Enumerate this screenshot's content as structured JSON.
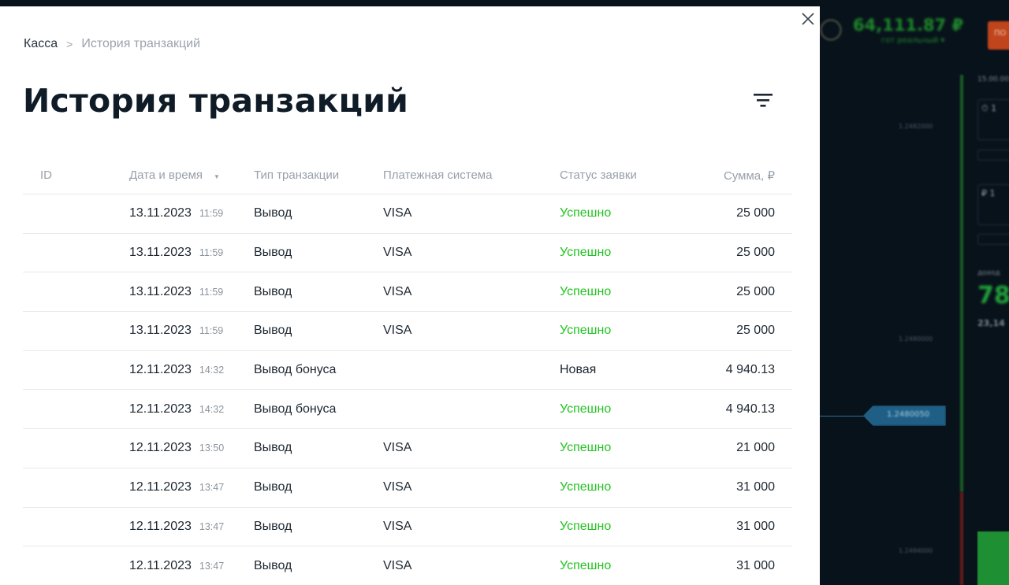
{
  "background": {
    "balance": "64,111.87 ₽",
    "balance_sub": "гот реальный ▾",
    "prices": [
      "1.2482000",
      "1.2480000",
      "1.2480050",
      "1.2484000"
    ],
    "big_value": "78",
    "small_value": "23,14"
  },
  "breadcrumb": {
    "root": "Касса",
    "separator": ">",
    "current": "История транзакций"
  },
  "title": "История транзакций",
  "table": {
    "headers": {
      "id": "ID",
      "date": "Дата и время",
      "type": "Тип транзакции",
      "payment": "Платежная система",
      "status": "Статус заявки",
      "sum": "Сумма, ₽"
    },
    "rows": [
      {
        "date": "13.11.2023",
        "time": "11:59",
        "type": "Вывод",
        "payment": "VISA",
        "status": "Успешно",
        "status_kind": "ok",
        "sum": "25 000"
      },
      {
        "date": "13.11.2023",
        "time": "11:59",
        "type": "Вывод",
        "payment": "VISA",
        "status": "Успешно",
        "status_kind": "ok",
        "sum": "25 000"
      },
      {
        "date": "13.11.2023",
        "time": "11:59",
        "type": "Вывод",
        "payment": "VISA",
        "status": "Успешно",
        "status_kind": "ok",
        "sum": "25 000"
      },
      {
        "date": "13.11.2023",
        "time": "11:59",
        "type": "Вывод",
        "payment": "VISA",
        "status": "Успешно",
        "status_kind": "ok",
        "sum": "25 000"
      },
      {
        "date": "12.11.2023",
        "time": "14:32",
        "type": "Вывод бонуса",
        "payment": "",
        "status": "Новая",
        "status_kind": "new",
        "sum": "4 940.13"
      },
      {
        "date": "12.11.2023",
        "time": "14:32",
        "type": "Вывод бонуса",
        "payment": "",
        "status": "Успешно",
        "status_kind": "ok",
        "sum": "4 940.13"
      },
      {
        "date": "12.11.2023",
        "time": "13:50",
        "type": "Вывод",
        "payment": "VISA",
        "status": "Успешно",
        "status_kind": "ok",
        "sum": "21 000"
      },
      {
        "date": "12.11.2023",
        "time": "13:47",
        "type": "Вывод",
        "payment": "VISA",
        "status": "Успешно",
        "status_kind": "ok",
        "sum": "31 000"
      },
      {
        "date": "12.11.2023",
        "time": "13:47",
        "type": "Вывод",
        "payment": "VISA",
        "status": "Успешно",
        "status_kind": "ok",
        "sum": "31 000"
      },
      {
        "date": "12.11.2023",
        "time": "13:47",
        "type": "Вывод",
        "payment": "VISA",
        "status": "Успешно",
        "status_kind": "ok",
        "sum": "31 000"
      }
    ]
  },
  "colors": {
    "success": "#22c322",
    "title": "#0f1b26",
    "muted": "#98a0a9"
  }
}
